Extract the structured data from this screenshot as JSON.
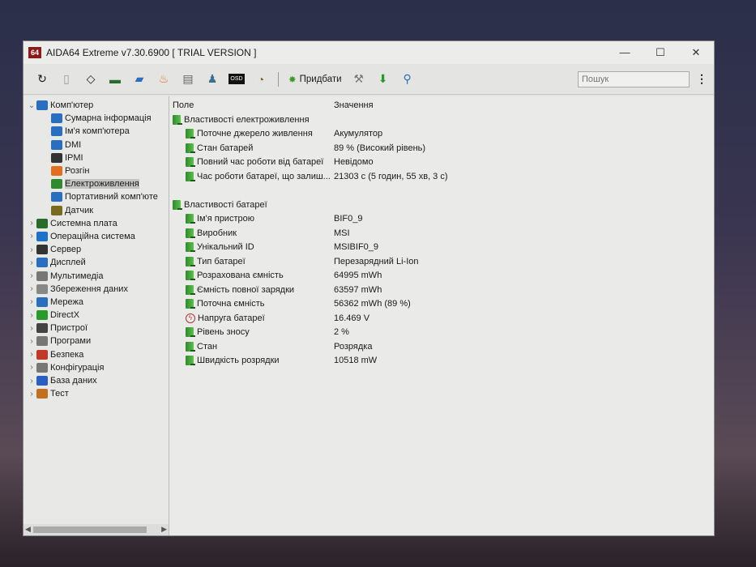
{
  "window": {
    "title": "AIDA64 Extreme v7.30.6900  [ TRIAL VERSION ]",
    "logo": "64",
    "controls": [
      "minimize",
      "maximize",
      "close"
    ]
  },
  "toolbar": {
    "icons": [
      "refresh-icon",
      "report-icon",
      "cpu-icon",
      "memory-icon",
      "network-icon",
      "flame-icon",
      "config-icon",
      "user-icon",
      "osd-icon",
      "gauge-icon"
    ],
    "add_label": "Придбати",
    "search_placeholder": "Пошук"
  },
  "tree": [
    {
      "label": "Комп'ютер",
      "level": 0,
      "expanded": true,
      "icon": "computer-icon"
    },
    {
      "label": "Сумарна інформація",
      "level": 1,
      "icon": "computer-icon"
    },
    {
      "label": "Ім'я комп'ютера",
      "level": 1,
      "icon": "computer-icon"
    },
    {
      "label": "DMI",
      "level": 1,
      "icon": "computer-icon"
    },
    {
      "label": "IPMI",
      "level": 1,
      "icon": "server-icon"
    },
    {
      "label": "Розгін",
      "level": 1,
      "icon": "flame-icon"
    },
    {
      "label": "Електроживлення",
      "level": 1,
      "icon": "power-icon",
      "selected": true
    },
    {
      "label": "Портативний комп'юте",
      "level": 1,
      "icon": "laptop-icon"
    },
    {
      "label": "Датчик",
      "level": 1,
      "icon": "gauge-icon"
    },
    {
      "label": "Системна плата",
      "level": 0,
      "icon": "motherboard-icon"
    },
    {
      "label": "Операційна система",
      "level": 0,
      "icon": "windows-icon"
    },
    {
      "label": "Сервер",
      "level": 0,
      "icon": "server-icon"
    },
    {
      "label": "Дисплей",
      "level": 0,
      "icon": "display-icon"
    },
    {
      "label": "Мультимедіа",
      "level": 0,
      "icon": "speaker-icon"
    },
    {
      "label": "Збереження даних",
      "level": 0,
      "icon": "storage-icon"
    },
    {
      "label": "Мережа",
      "level": 0,
      "icon": "network-icon"
    },
    {
      "label": "DirectX",
      "level": 0,
      "icon": "xbox-icon"
    },
    {
      "label": "Пристрої",
      "level": 0,
      "icon": "devices-icon"
    },
    {
      "label": "Програми",
      "level": 0,
      "icon": "programs-icon"
    },
    {
      "label": "Безпека",
      "level": 0,
      "icon": "shield-icon"
    },
    {
      "label": "Конфігурація",
      "level": 0,
      "icon": "config-icon"
    },
    {
      "label": "База даних",
      "level": 0,
      "icon": "database-icon"
    },
    {
      "label": "Тест",
      "level": 0,
      "icon": "test-icon"
    }
  ],
  "columns": {
    "field": "Поле",
    "value": "Значення"
  },
  "groups": [
    {
      "title": "Властивості електроживлення",
      "rows": [
        {
          "field": "Поточне джерело живлення",
          "value": "Акумулятор"
        },
        {
          "field": "Стан батарей",
          "value": "89 % (Високий рівень)"
        },
        {
          "field": "Повний час роботи від батареї",
          "value": "Невідомо"
        },
        {
          "field": "Час роботи батареї, що залиш...",
          "value": "21303 с (5 годин, 55 хв, 3 с)"
        }
      ]
    },
    {
      "title": "Властивості батареї",
      "rows": [
        {
          "field": "Ім'я пристрою",
          "value": "BIF0_9"
        },
        {
          "field": "Виробник",
          "value": "MSI"
        },
        {
          "field": "Унікальний ID",
          "value": "MSIBIF0_9"
        },
        {
          "field": "Тип батареї",
          "value": "Перезарядний Li-Ion"
        },
        {
          "field": "Розрахована ємність",
          "value": "64995 mWh"
        },
        {
          "field": "Ємність повної зарядки",
          "value": "63597 mWh"
        },
        {
          "field": "Поточна ємність",
          "value": "56362 mWh  (89 %)"
        },
        {
          "field": "Напруга батареї",
          "value": "16.469 V",
          "icon": "voltage-icon"
        },
        {
          "field": "Рівень зносу",
          "value": "2 %"
        },
        {
          "field": "Стан",
          "value": "Розрядка"
        },
        {
          "field": "Швидкість розрядки",
          "value": "10518 mW"
        }
      ]
    }
  ]
}
